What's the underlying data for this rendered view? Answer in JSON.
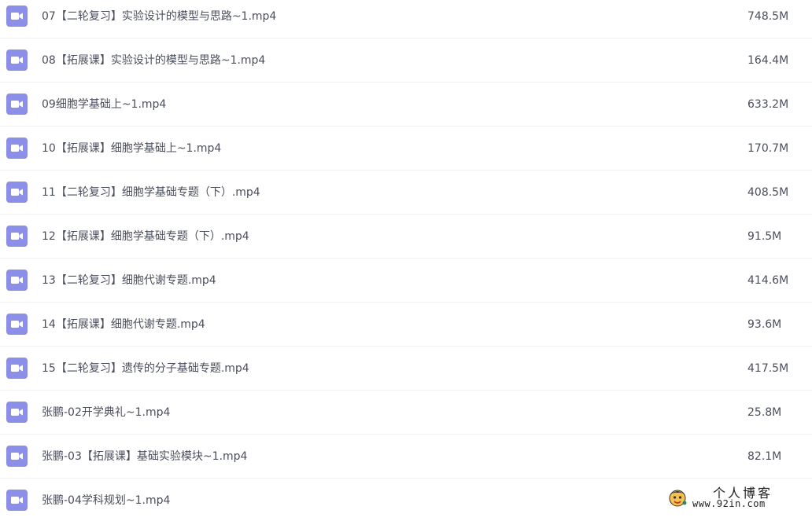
{
  "files": [
    {
      "name": "07【二轮复习】实验设计的模型与思路~1.mp4",
      "size": "748.5M",
      "icon": "video-file-icon"
    },
    {
      "name": "08【拓展课】实验设计的模型与思路~1.mp4",
      "size": "164.4M",
      "icon": "video-file-icon"
    },
    {
      "name": "09细胞学基础上~1.mp4",
      "size": "633.2M",
      "icon": "video-file-icon"
    },
    {
      "name": "10【拓展课】细胞学基础上~1.mp4",
      "size": "170.7M",
      "icon": "video-file-icon"
    },
    {
      "name": "11【二轮复习】细胞学基础专题（下）.mp4",
      "size": "408.5M",
      "icon": "video-file-icon"
    },
    {
      "name": "12【拓展课】细胞学基础专题（下）.mp4",
      "size": "91.5M",
      "icon": "video-file-icon"
    },
    {
      "name": "13【二轮复习】细胞代谢专题.mp4",
      "size": "414.6M",
      "icon": "video-file-icon"
    },
    {
      "name": "14【拓展课】细胞代谢专题.mp4",
      "size": "93.6M",
      "icon": "video-file-icon"
    },
    {
      "name": "15【二轮复习】遗传的分子基础专题.mp4",
      "size": "417.5M",
      "icon": "video-file-icon"
    },
    {
      "name": "张鹏-02开学典礼~1.mp4",
      "size": "25.8M",
      "icon": "video-file-icon"
    },
    {
      "name": "张鹏-03【拓展课】基础实验模块~1.mp4",
      "size": "82.1M",
      "icon": "video-file-icon"
    },
    {
      "name": "张鹏-04学科规划~1.mp4",
      "size": "",
      "icon": "video-file-icon"
    }
  ],
  "watermark": {
    "title": "个人博客",
    "url": "www.92in.com"
  },
  "colors": {
    "icon_bg": "#8b8fe8",
    "text": "#4a4f5c",
    "divider": "#eef0f4"
  }
}
